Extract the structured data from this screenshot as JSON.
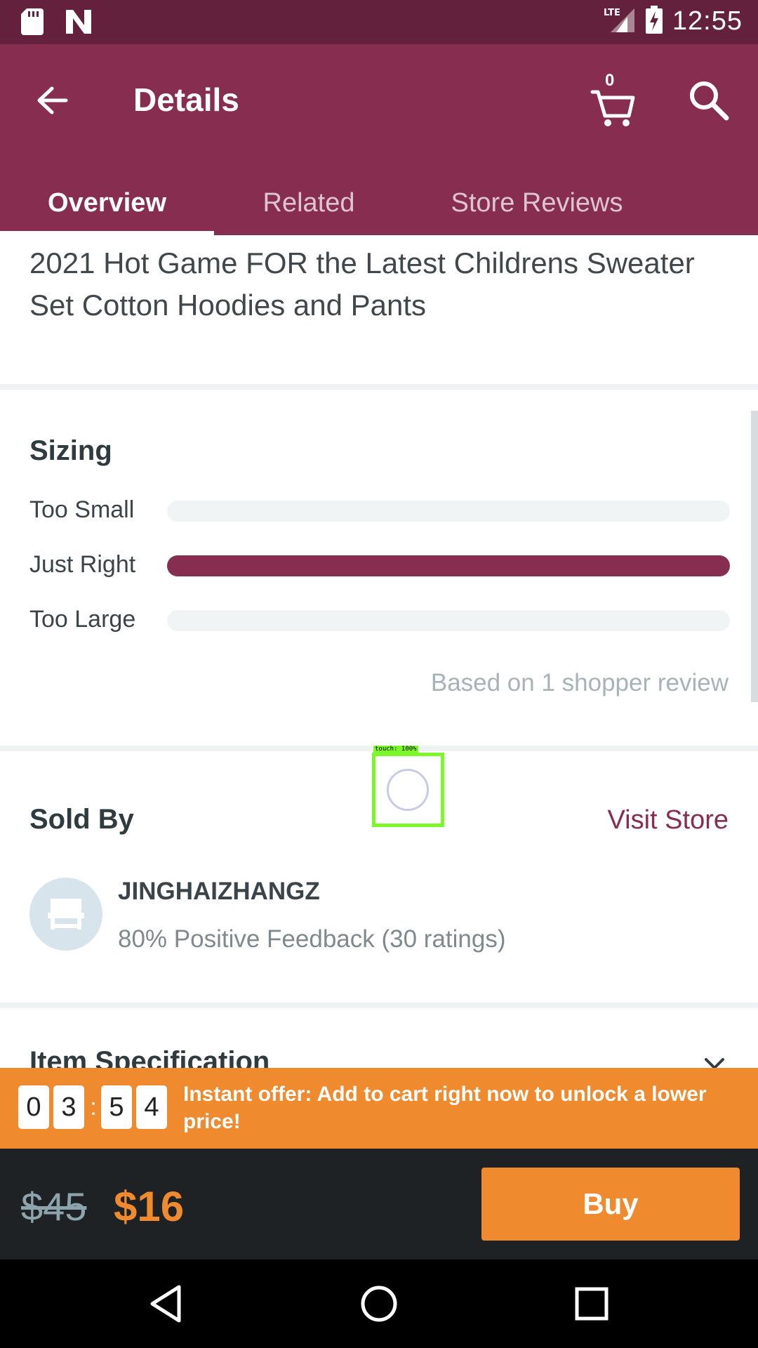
{
  "status_bar": {
    "network": "LTE",
    "time": "12:55"
  },
  "app_bar": {
    "title": "Details",
    "cart_count": "0"
  },
  "tabs": [
    {
      "label": "Overview",
      "active": true
    },
    {
      "label": "Related",
      "active": false
    },
    {
      "label": "Store Reviews",
      "active": false
    }
  ],
  "product": {
    "title": "2021 Hot Game FOR the Latest Childrens Sweater Set Cotton Hoodies and Pants"
  },
  "sizing": {
    "title": "Sizing",
    "rows": [
      {
        "label": "Too Small",
        "fraction": 0
      },
      {
        "label": "Just Right",
        "fraction": 1
      },
      {
        "label": "Too Large",
        "fraction": 0
      }
    ],
    "note": "Based on 1 shopper review"
  },
  "touch_overlay": {
    "label": "touch: 100%"
  },
  "seller": {
    "section_title": "Sold By",
    "visit_label": "Visit Store",
    "name": "JINGHAIZHANGZ",
    "feedback": "80% Positive Feedback (30 ratings)"
  },
  "spec": {
    "title": "Item Specification"
  },
  "offer": {
    "timer_digits": [
      "0",
      "3",
      "5",
      "4"
    ],
    "separator": ":",
    "text": "Instant offer: Add to cart right now to unlock a lower price!"
  },
  "purchase": {
    "old_price": "$45",
    "new_price": "$16",
    "buy_label": "Buy"
  },
  "colors": {
    "brand": "#872d4f",
    "status_bar": "#64213d",
    "accent": "#ef8a2e"
  }
}
